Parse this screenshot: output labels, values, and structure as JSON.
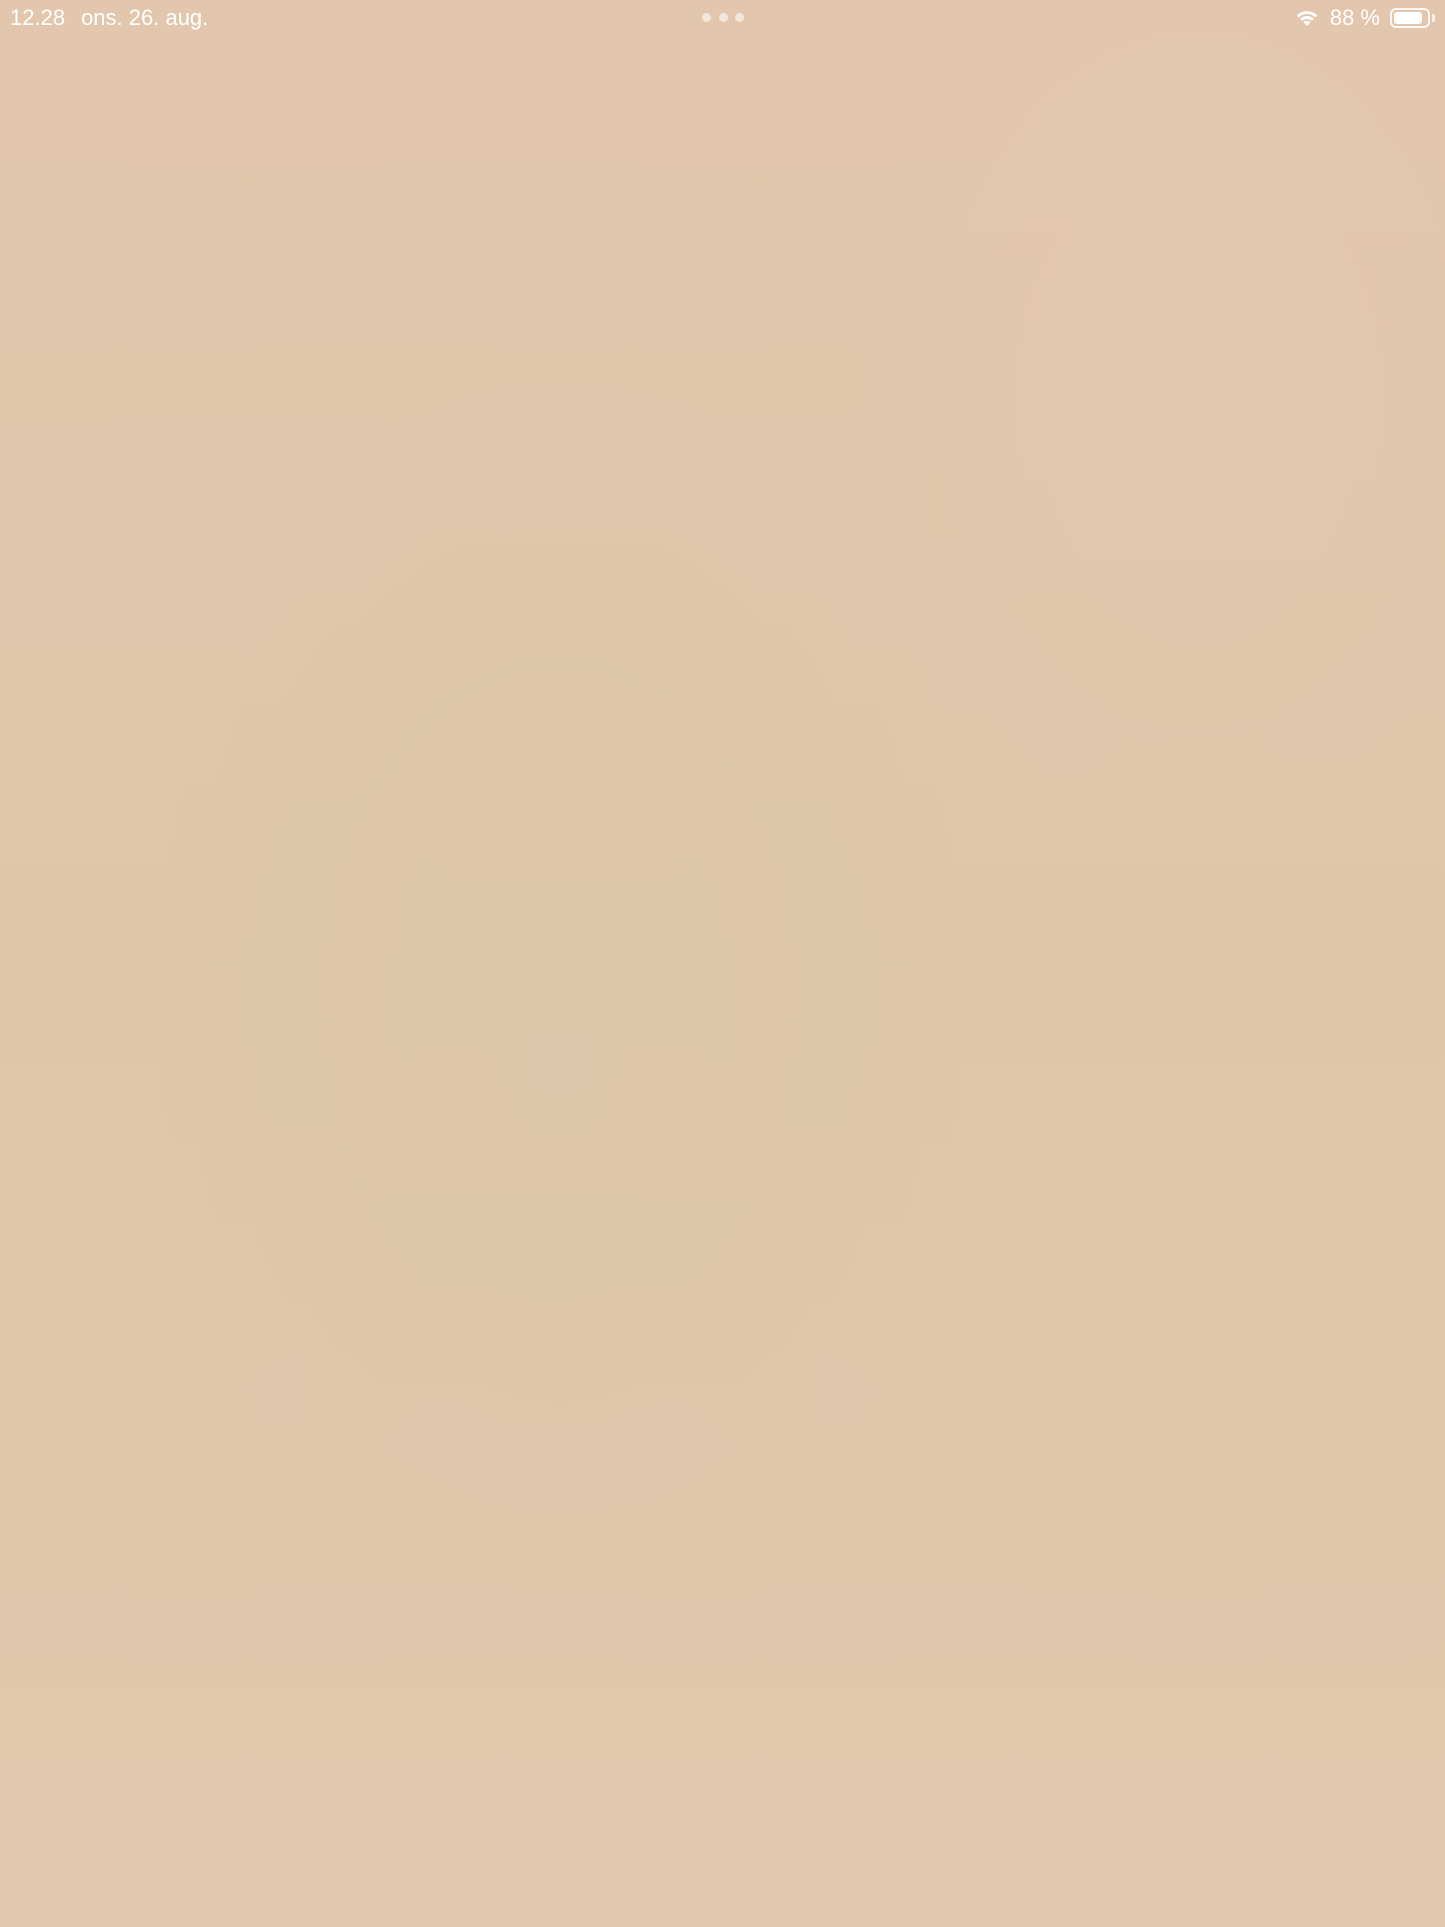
{
  "status_bar": {
    "time": "12.28",
    "date": "ons. 26. aug.",
    "battery_text": "88 %",
    "battery_level": 0.88,
    "wifi_icon": "wifi-icon",
    "battery_icon": "battery-icon",
    "multitask_icon": "multitasking-dots-icon"
  },
  "colors": {
    "background": "#e1c7ad",
    "status_text": "#ffffff"
  }
}
